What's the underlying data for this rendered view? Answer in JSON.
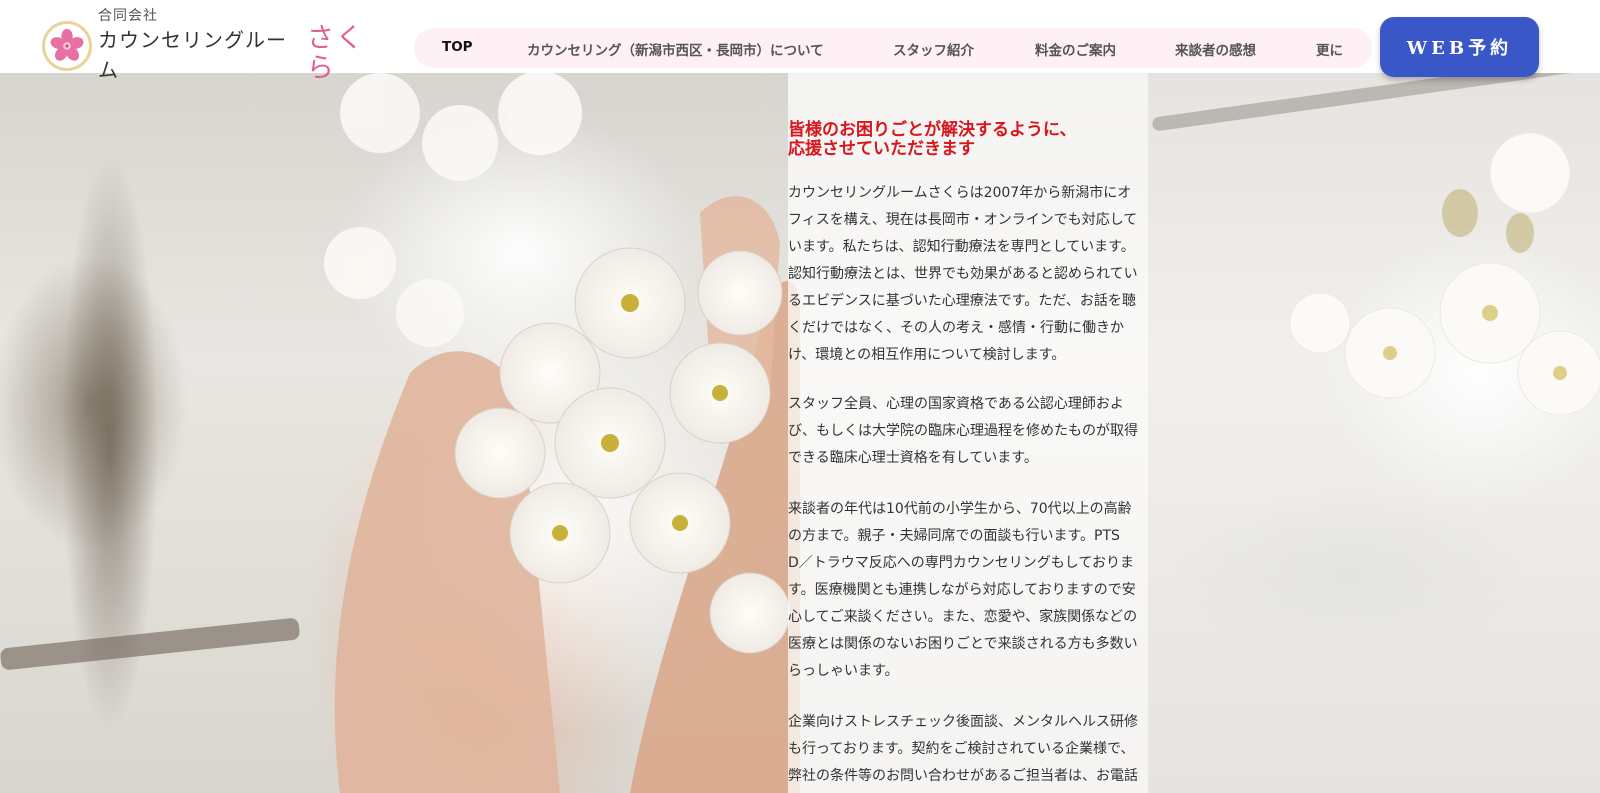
{
  "header": {
    "logo": {
      "subtitle": "合同会社",
      "name": "カウンセリングルーム",
      "sakura": "さくら",
      "icon": "sakura-flower-icon"
    },
    "nav": [
      {
        "label": "TOP",
        "active": true
      },
      {
        "label": "カウンセリング（新潟市西区・長岡市）について",
        "active": false
      },
      {
        "label": "スタッフ紹介",
        "active": false
      },
      {
        "label": "料金のご案内",
        "active": false
      },
      {
        "label": "来談者の感想",
        "active": false
      },
      {
        "label": "更に",
        "active": false
      }
    ],
    "cta_label": "WEB予約"
  },
  "hero": {
    "headline": [
      "皆様のお困りごとが解決するように、",
      "応援させていただきます"
    ],
    "paragraphs": [
      [
        "カウンセリングルームさくらは2007年から新潟市にオ",
        "フィスを構え、現在は長岡市・オンラインでも対応して",
        "います。私たちは、認知行動療法を専門としています。",
        "認知行動療法とは、世界でも効果があると認められてい",
        "るエビデンスに基づいた心理療法です。ただ、お話を聴",
        "くだけではなく、その人の考え・感情・行動に働きか",
        "け、環境との相互作用について検討します。"
      ],
      [
        "スタッフ全員、心理の国家資格である公認心理師およ",
        "び、もしくは大学院の臨床心理過程を修めたものが取得",
        "できる臨床心理士資格を有しています。"
      ],
      [
        "来談者の年代は10代前の小学生から、70代以上の高齢",
        "の方まで。親子・夫婦同席での面談も行います。PTS",
        "D／トラウマ反応への専門カウンセリングもしておりま",
        "す。医療機関とも連携しながら対応しておりますので安",
        "心してご来談ください。また、恋愛や、家族関係などの",
        "医療とは関係のないお困りごとで来談される方も多数い",
        "らっしゃいます。"
      ],
      [
        "企業向けストレスチェック後面談、メンタルヘルス研修",
        "も行っております。契約をご検討されている企業様で、",
        "弊社の条件等のお問い合わせがあるご担当者は、お電話"
      ]
    ]
  },
  "colors": {
    "accent_pink": "#e05f96",
    "nav_bg": "#fff0f5",
    "cta_bg": "#3a57c8",
    "headline_red": "#d8151d"
  }
}
